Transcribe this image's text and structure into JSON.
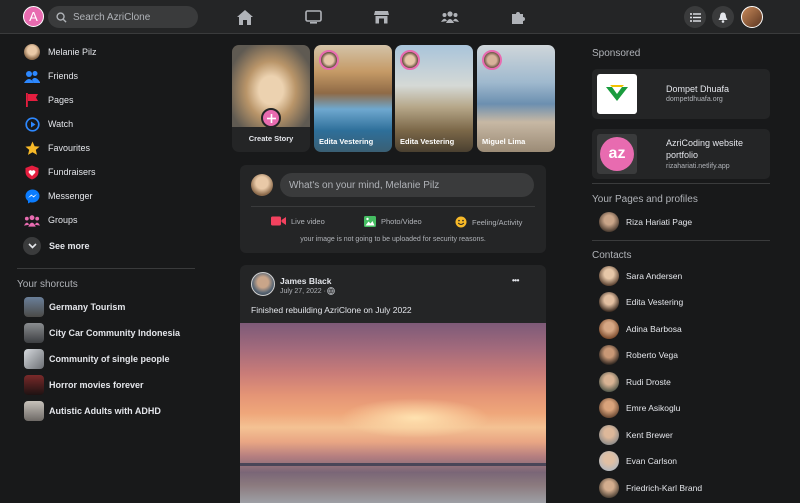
{
  "app": {
    "logo_letter": "A"
  },
  "search": {
    "placeholder": "Search AzriClone"
  },
  "top_nav": [
    "home-icon",
    "watch-icon",
    "marketplace-icon",
    "groups-icon",
    "gaming-icon"
  ],
  "left_sidebar": {
    "user": "Melanie Pilz",
    "items": [
      {
        "label": "Friends",
        "icon": "friends-icon"
      },
      {
        "label": "Pages",
        "icon": "flag-icon"
      },
      {
        "label": "Watch",
        "icon": "watch-icon"
      },
      {
        "label": "Favourites",
        "icon": "star-icon"
      },
      {
        "label": "Fundraisers",
        "icon": "heart-icon"
      },
      {
        "label": "Messenger",
        "icon": "messenger-icon"
      },
      {
        "label": "Groups",
        "icon": "groups-icon"
      }
    ],
    "see_more": "See more",
    "shortcuts_title": "Your shorcuts",
    "shortcuts": [
      "Germany Tourism",
      "City Car Community Indonesia",
      "Community of single people",
      "Horror movies forever",
      "Autistic Adults with ADHD"
    ]
  },
  "stories": {
    "create_label": "Create Story",
    "items": [
      "Edita Vestering",
      "Edita Vestering",
      "Miguel Lima"
    ]
  },
  "composer": {
    "placeholder": "What's on your mind, Melanie Pilz",
    "live": "Live video",
    "photo": "Photo/Video",
    "feeling": "Feeling/Activity",
    "notice": "your image is not going to be uploaded for security reasons."
  },
  "post": {
    "author": "James Black",
    "date": "July 27, 2022 · ",
    "text": "Finished rebuilding AzriClone on July 2022",
    "more": "•••"
  },
  "right": {
    "sponsored_title": "Sponsored",
    "ads": [
      {
        "title": "Dompet Dhuafa",
        "url": "dompetdhuafa.org"
      },
      {
        "title": "AzriCoding website portfolio",
        "url": "rizahariati.netlify.app",
        "logo": "az"
      }
    ],
    "pages_title": "Your Pages and profiles",
    "page": "Riza Hariati Page",
    "contacts_title": "Contacts",
    "contacts": [
      "Sara Andersen",
      "Edita Vestering",
      "Adina Barbosa",
      "Roberto Vega",
      "Rudi Droste",
      "Emre Asikoglu",
      "Kent Brewer",
      "Evan Carlson",
      "Friedrich-Karl Brand"
    ]
  },
  "colors": {
    "accent": "#e86bb0",
    "background": "#18191a",
    "card": "#242526"
  }
}
